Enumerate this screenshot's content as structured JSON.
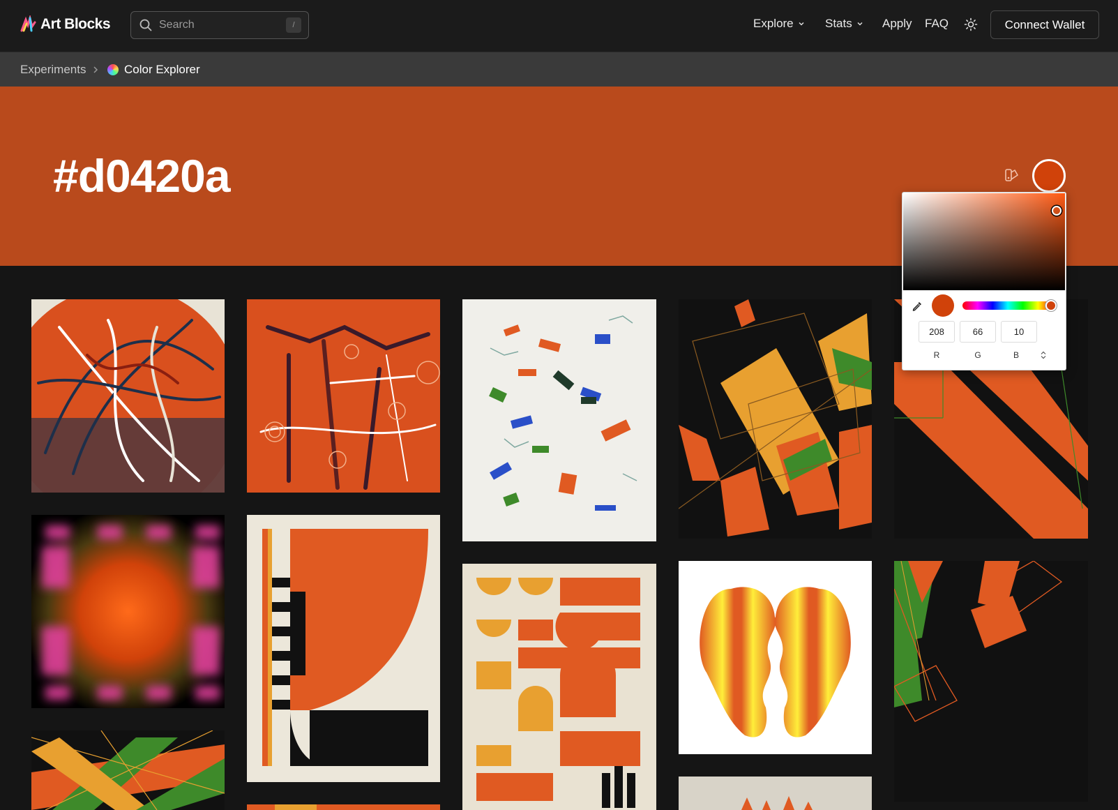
{
  "brand": {
    "name": "Art Blocks"
  },
  "search": {
    "placeholder": "Search",
    "shortcut": "/"
  },
  "nav": {
    "explore": "Explore",
    "stats": "Stats",
    "apply": "Apply",
    "faq": "FAQ",
    "connect": "Connect Wallet"
  },
  "breadcrumb": {
    "parent": "Experiments",
    "current": "Color Explorer"
  },
  "hero": {
    "hex": "#d0420a",
    "background": "#b94a1c"
  },
  "picker": {
    "selected_color": "#d0420a",
    "r": "208",
    "g": "66",
    "b": "10",
    "r_label": "R",
    "g_label": "G",
    "b_label": "B"
  },
  "icons": {
    "logo": "art-blocks-logo-icon",
    "search": "search-icon",
    "chevron": "chevron-down-icon",
    "theme": "sun-icon",
    "breadcrumb_separator": "chevron-right-icon",
    "palette": "palette-icon",
    "eyedropper": "eyedropper-icon",
    "mode": "up-down-arrows-icon"
  },
  "colors": {
    "accent": "#d0420a",
    "orange": "#e05a22",
    "amber": "#e8a030",
    "green": "#3e8a2a",
    "navy": "#1d2f4a",
    "cream": "#e8e3d6"
  }
}
